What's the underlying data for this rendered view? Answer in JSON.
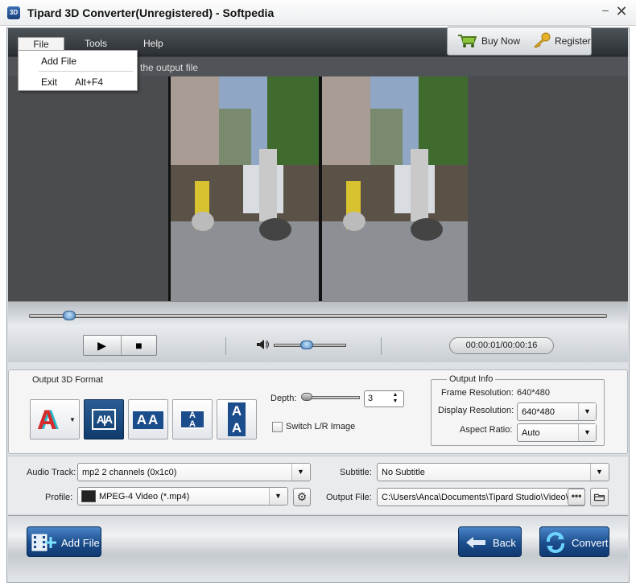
{
  "window": {
    "title": "Tipard 3D Converter(Unregistered) - Softpedia",
    "app_icon": "3D",
    "minimize": "–",
    "close": "✕"
  },
  "menu": {
    "file": "File",
    "tools": "Tools",
    "help": "Help"
  },
  "file_menu": {
    "add_file": "Add File",
    "exit": "Exit",
    "exit_shortcut": "Alt+F4"
  },
  "top_buttons": {
    "buy_now": "Buy Now",
    "register": "Register"
  },
  "preview": {
    "hint": "the output file"
  },
  "player": {
    "time": "00:00:01/00:00:16",
    "seek_fraction": 0.06,
    "volume_fraction": 0.45,
    "play_icon": "▶",
    "stop_icon": "■"
  },
  "format": {
    "label": "Output 3D Format",
    "depth_label": "Depth:",
    "depth_value": "3",
    "swap_label": "Switch L/R Image",
    "anaglyph_glyph": "A",
    "side_glyph": "A|A",
    "half_side_glyph": "AA",
    "top_bottom_glyph": "A",
    "full_tb_glyph": "A"
  },
  "output_info": {
    "legend": "Output Info",
    "frame_res_label": "Frame Resolution:",
    "frame_res_value": "640*480",
    "display_res_label": "Display Resolution:",
    "display_res_value": "640*480",
    "aspect_label": "Aspect Ratio:",
    "aspect_value": "Auto"
  },
  "io": {
    "audio_label": "Audio Track:",
    "audio_value": "mp2 2 channels (0x1c0)",
    "subtitle_label": "Subtitle:",
    "subtitle_value": "No Subtitle",
    "profile_label": "Profile:",
    "profile_value": "MPEG-4 Video (*.mp4)",
    "output_label": "Output File:",
    "output_value": "C:\\Users\\Anca\\Documents\\Tipard Studio\\Video\\S",
    "dots": "•••"
  },
  "bottom": {
    "add_file": "Add File",
    "back": "Back",
    "convert": "Convert"
  },
  "colors": {
    "accent": "#1b4c8c",
    "menubar": "#3a3e42",
    "panel": "#f5f5f5"
  }
}
